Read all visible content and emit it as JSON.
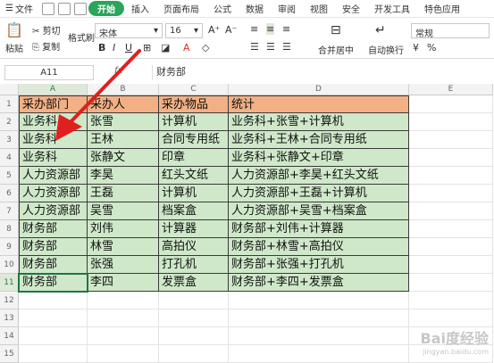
{
  "menubar": {
    "file": "文件",
    "items": [
      "开始",
      "插入",
      "页面布局",
      "公式",
      "数据",
      "审阅",
      "视图",
      "安全",
      "开发工具",
      "特色应用"
    ]
  },
  "ribbon": {
    "paste": "粘贴",
    "cut": "剪切",
    "copy": "复制",
    "format_painter": "格式刷",
    "font_name": "宋体",
    "font_size": "16",
    "merge_center": "合并居中",
    "wrap": "自动换行",
    "number_format": "常规"
  },
  "formula_bar": {
    "cell_ref": "A11",
    "fx": "fx",
    "value": "财务部"
  },
  "columns": [
    "A",
    "B",
    "C",
    "D",
    "E"
  ],
  "rows": [
    "1",
    "2",
    "3",
    "4",
    "5",
    "6",
    "7",
    "8",
    "9",
    "10",
    "11",
    "12",
    "13",
    "14",
    "15"
  ],
  "table": {
    "headers": [
      "采办部门",
      "采办人",
      "采办物品",
      "统计"
    ],
    "rows": [
      [
        "业务科",
        "张雪",
        "计算机",
        "业务科+张雪+计算机"
      ],
      [
        "业务科",
        "王林",
        "合同专用纸",
        "业务科+王林+合同专用纸"
      ],
      [
        "业务科",
        "张静文",
        "印章",
        "业务科+张静文+印章"
      ],
      [
        "人力资源部",
        "李昊",
        "红头文纸",
        "人力资源部+李昊+红头文纸"
      ],
      [
        "人力资源部",
        "王磊",
        "计算机",
        "人力资源部+王磊+计算机"
      ],
      [
        "人力资源部",
        "吴雪",
        "档案盒",
        "人力资源部+吴雪+档案盒"
      ],
      [
        "财务部",
        "刘伟",
        "计算器",
        "财务部+刘伟+计算器"
      ],
      [
        "财务部",
        "林雪",
        "高拍仪",
        "财务部+林雪+高拍仪"
      ],
      [
        "财务部",
        "张强",
        "打孔机",
        "财务部+张强+打孔机"
      ],
      [
        "财务部",
        "李四",
        "发票盒",
        "财务部+李四+发票盒"
      ]
    ]
  },
  "watermark": {
    "main": "Bai度经验",
    "sub": "jingyan.baidu.com"
  },
  "colors": {
    "header_fill": "#f2b084",
    "body_fill": "#cfe8c9",
    "accent": "#2aa55a",
    "arrow": "#e0201f"
  }
}
